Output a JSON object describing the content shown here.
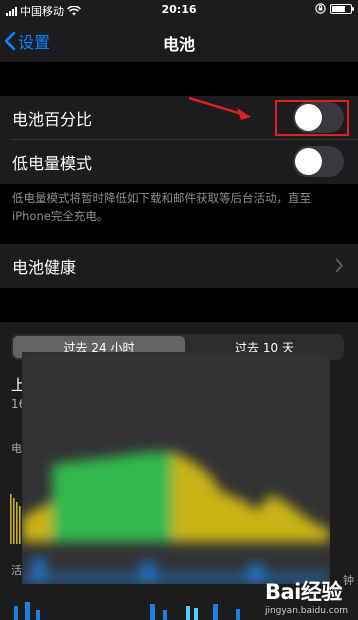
{
  "status_bar": {
    "carrier": "中国移动",
    "time": "20:16"
  },
  "nav": {
    "back_label": "设置",
    "title": "电池"
  },
  "settings": {
    "battery_percentage_label": "电池百分比",
    "battery_percentage_on": false,
    "low_power_label": "低电量模式",
    "low_power_on": false,
    "low_power_footnote": "低电量模式将暂时降低如下载和邮件获取等后台活动，直至iPhone完全充电。",
    "battery_health_label": "电池健康"
  },
  "usage": {
    "tabs": [
      "过去 24 小时",
      "过去 10 天"
    ],
    "selected_tab": 0,
    "partial_labels": {
      "last_charge_fragment": "上",
      "time_fragment": "16",
      "battery_level_fragment": "电",
      "activity_fragment": "活",
      "right_edge_fragment": "钟"
    }
  },
  "watermark": {
    "logo": "Bai经验",
    "url": "jingyan.baidu.com"
  },
  "colors": {
    "accent": "#0a84ff",
    "highlight_red": "#e02020",
    "chart_green": "#30b94d",
    "chart_yellow": "#c9b416",
    "chart_blue": "#1f7fe0"
  }
}
